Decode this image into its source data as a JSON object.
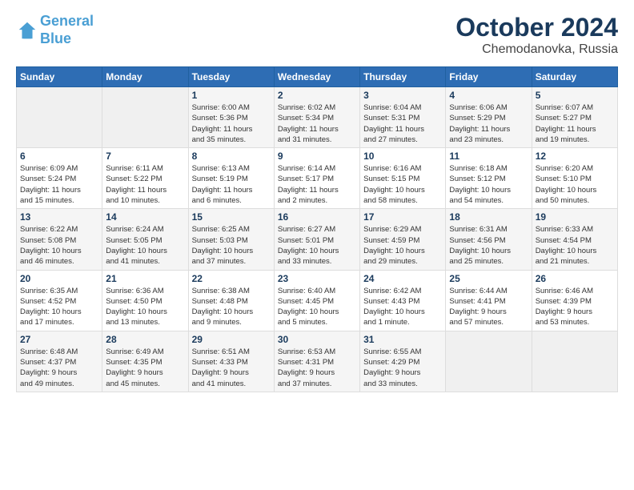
{
  "header": {
    "logo_line1": "General",
    "logo_line2": "Blue",
    "month": "October 2024",
    "location": "Chemodanovka, Russia"
  },
  "weekdays": [
    "Sunday",
    "Monday",
    "Tuesday",
    "Wednesday",
    "Thursday",
    "Friday",
    "Saturday"
  ],
  "weeks": [
    [
      {
        "day": "",
        "info": ""
      },
      {
        "day": "",
        "info": ""
      },
      {
        "day": "1",
        "info": "Sunrise: 6:00 AM\nSunset: 5:36 PM\nDaylight: 11 hours\nand 35 minutes."
      },
      {
        "day": "2",
        "info": "Sunrise: 6:02 AM\nSunset: 5:34 PM\nDaylight: 11 hours\nand 31 minutes."
      },
      {
        "day": "3",
        "info": "Sunrise: 6:04 AM\nSunset: 5:31 PM\nDaylight: 11 hours\nand 27 minutes."
      },
      {
        "day": "4",
        "info": "Sunrise: 6:06 AM\nSunset: 5:29 PM\nDaylight: 11 hours\nand 23 minutes."
      },
      {
        "day": "5",
        "info": "Sunrise: 6:07 AM\nSunset: 5:27 PM\nDaylight: 11 hours\nand 19 minutes."
      }
    ],
    [
      {
        "day": "6",
        "info": "Sunrise: 6:09 AM\nSunset: 5:24 PM\nDaylight: 11 hours\nand 15 minutes."
      },
      {
        "day": "7",
        "info": "Sunrise: 6:11 AM\nSunset: 5:22 PM\nDaylight: 11 hours\nand 10 minutes."
      },
      {
        "day": "8",
        "info": "Sunrise: 6:13 AM\nSunset: 5:19 PM\nDaylight: 11 hours\nand 6 minutes."
      },
      {
        "day": "9",
        "info": "Sunrise: 6:14 AM\nSunset: 5:17 PM\nDaylight: 11 hours\nand 2 minutes."
      },
      {
        "day": "10",
        "info": "Sunrise: 6:16 AM\nSunset: 5:15 PM\nDaylight: 10 hours\nand 58 minutes."
      },
      {
        "day": "11",
        "info": "Sunrise: 6:18 AM\nSunset: 5:12 PM\nDaylight: 10 hours\nand 54 minutes."
      },
      {
        "day": "12",
        "info": "Sunrise: 6:20 AM\nSunset: 5:10 PM\nDaylight: 10 hours\nand 50 minutes."
      }
    ],
    [
      {
        "day": "13",
        "info": "Sunrise: 6:22 AM\nSunset: 5:08 PM\nDaylight: 10 hours\nand 46 minutes."
      },
      {
        "day": "14",
        "info": "Sunrise: 6:24 AM\nSunset: 5:05 PM\nDaylight: 10 hours\nand 41 minutes."
      },
      {
        "day": "15",
        "info": "Sunrise: 6:25 AM\nSunset: 5:03 PM\nDaylight: 10 hours\nand 37 minutes."
      },
      {
        "day": "16",
        "info": "Sunrise: 6:27 AM\nSunset: 5:01 PM\nDaylight: 10 hours\nand 33 minutes."
      },
      {
        "day": "17",
        "info": "Sunrise: 6:29 AM\nSunset: 4:59 PM\nDaylight: 10 hours\nand 29 minutes."
      },
      {
        "day": "18",
        "info": "Sunrise: 6:31 AM\nSunset: 4:56 PM\nDaylight: 10 hours\nand 25 minutes."
      },
      {
        "day": "19",
        "info": "Sunrise: 6:33 AM\nSunset: 4:54 PM\nDaylight: 10 hours\nand 21 minutes."
      }
    ],
    [
      {
        "day": "20",
        "info": "Sunrise: 6:35 AM\nSunset: 4:52 PM\nDaylight: 10 hours\nand 17 minutes."
      },
      {
        "day": "21",
        "info": "Sunrise: 6:36 AM\nSunset: 4:50 PM\nDaylight: 10 hours\nand 13 minutes."
      },
      {
        "day": "22",
        "info": "Sunrise: 6:38 AM\nSunset: 4:48 PM\nDaylight: 10 hours\nand 9 minutes."
      },
      {
        "day": "23",
        "info": "Sunrise: 6:40 AM\nSunset: 4:45 PM\nDaylight: 10 hours\nand 5 minutes."
      },
      {
        "day": "24",
        "info": "Sunrise: 6:42 AM\nSunset: 4:43 PM\nDaylight: 10 hours\nand 1 minute."
      },
      {
        "day": "25",
        "info": "Sunrise: 6:44 AM\nSunset: 4:41 PM\nDaylight: 9 hours\nand 57 minutes."
      },
      {
        "day": "26",
        "info": "Sunrise: 6:46 AM\nSunset: 4:39 PM\nDaylight: 9 hours\nand 53 minutes."
      }
    ],
    [
      {
        "day": "27",
        "info": "Sunrise: 6:48 AM\nSunset: 4:37 PM\nDaylight: 9 hours\nand 49 minutes."
      },
      {
        "day": "28",
        "info": "Sunrise: 6:49 AM\nSunset: 4:35 PM\nDaylight: 9 hours\nand 45 minutes."
      },
      {
        "day": "29",
        "info": "Sunrise: 6:51 AM\nSunset: 4:33 PM\nDaylight: 9 hours\nand 41 minutes."
      },
      {
        "day": "30",
        "info": "Sunrise: 6:53 AM\nSunset: 4:31 PM\nDaylight: 9 hours\nand 37 minutes."
      },
      {
        "day": "31",
        "info": "Sunrise: 6:55 AM\nSunset: 4:29 PM\nDaylight: 9 hours\nand 33 minutes."
      },
      {
        "day": "",
        "info": ""
      },
      {
        "day": "",
        "info": ""
      }
    ]
  ]
}
